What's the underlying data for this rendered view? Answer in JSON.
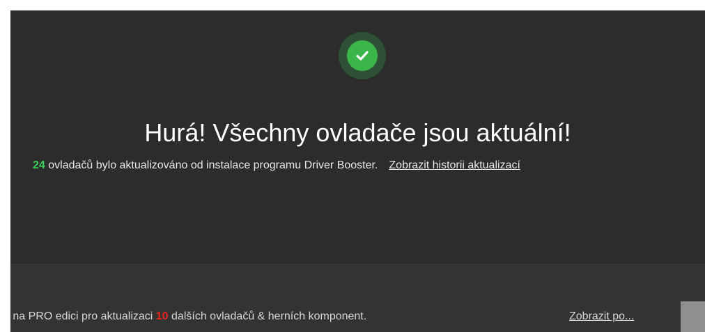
{
  "status": {
    "icon": "check-circle-icon",
    "title": "Hurá! Všechny ovladače jsou aktuální!",
    "updated_count": "24",
    "updated_text": " ovladačů bylo aktualizováno od instalace programu Driver Booster.",
    "history_link": "Zobrazit historii aktualizací"
  },
  "footer": {
    "promo_prefix": "e na PRO edici pro aktualizaci ",
    "promo_count": "10",
    "promo_suffix": " dalších ovladačů & herních komponent.",
    "details_link": "Zobrazit po..."
  },
  "colors": {
    "background": "#2c2c2c",
    "success_green": "#39b54a",
    "count_green": "#3ccf5a",
    "count_red": "#e8231b"
  }
}
